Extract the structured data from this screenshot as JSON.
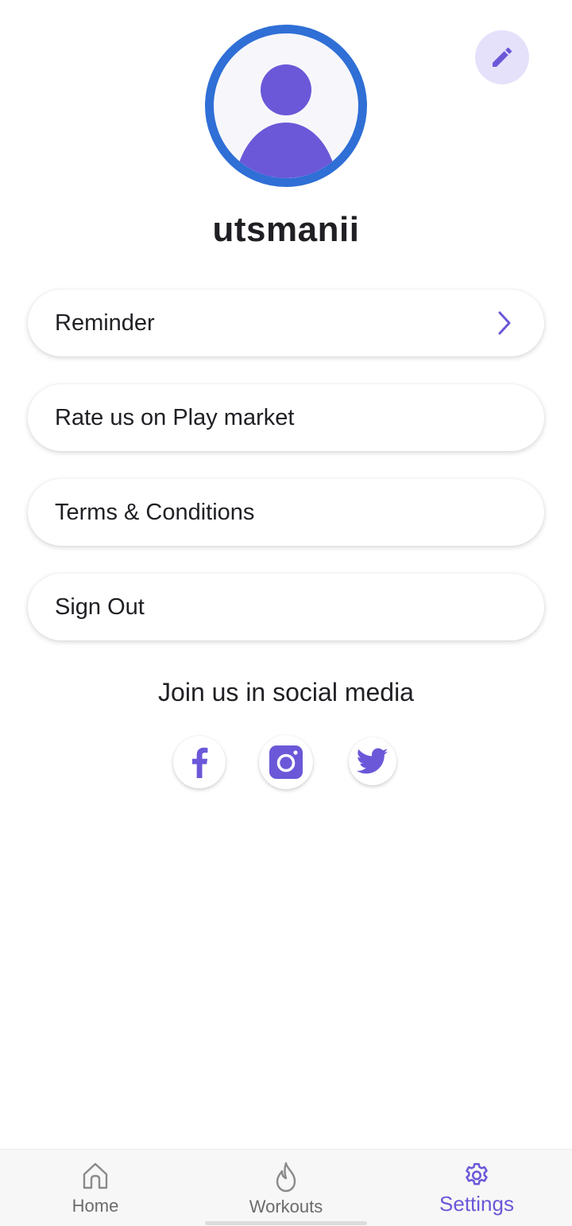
{
  "profile": {
    "username": "utsmanii",
    "avatar_icon": "user-silhouette-icon",
    "edit_icon": "pencil-icon"
  },
  "menu": [
    {
      "label": "Reminder",
      "has_chevron": true
    },
    {
      "label": "Rate us on Play market",
      "has_chevron": false
    },
    {
      "label": "Terms & Conditions",
      "has_chevron": false
    },
    {
      "label": "Sign Out",
      "has_chevron": false
    }
  ],
  "social": {
    "title": "Join us in social media",
    "links": [
      {
        "name": "facebook",
        "icon": "facebook-icon"
      },
      {
        "name": "instagram",
        "icon": "instagram-icon"
      },
      {
        "name": "twitter",
        "icon": "twitter-icon"
      }
    ]
  },
  "bottom_nav": {
    "items": [
      {
        "label": "Home",
        "icon": "home-icon",
        "active": false
      },
      {
        "label": "Workouts",
        "icon": "flame-icon",
        "active": false
      },
      {
        "label": "Settings",
        "icon": "gear-icon",
        "active": true
      }
    ]
  },
  "colors": {
    "accent": "#6a58d8",
    "avatar_ring": "#2f6fd6",
    "edit_button_bg": "#e5e1fb",
    "text": "#1f1f24",
    "inactive_nav": "#6b6b6b"
  }
}
